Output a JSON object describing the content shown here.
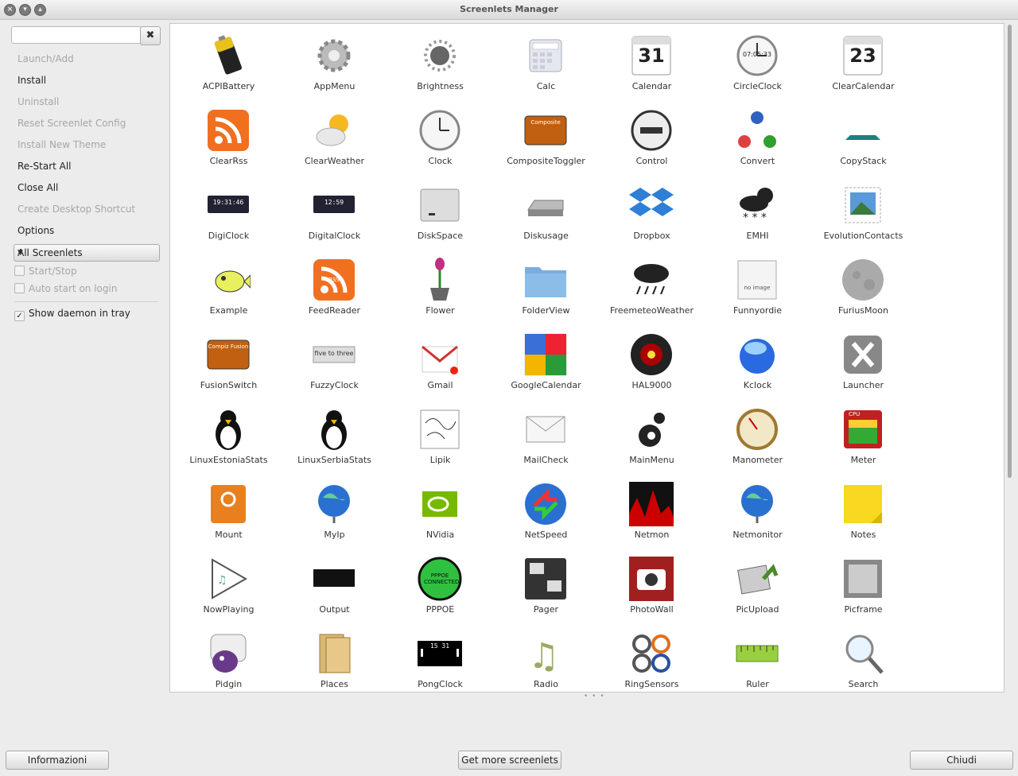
{
  "window": {
    "title": "Screenlets Manager"
  },
  "sidebar": {
    "search": {
      "value": "",
      "placeholder": ""
    },
    "clear_label": "✖",
    "menu": [
      {
        "label": "Launch/Add",
        "enabled": false
      },
      {
        "label": "Install",
        "enabled": true
      },
      {
        "label": "Uninstall",
        "enabled": false
      },
      {
        "label": "Reset Screenlet Config",
        "enabled": false
      },
      {
        "label": "Install New Theme",
        "enabled": false
      },
      {
        "label": "Re-Start All",
        "enabled": true
      },
      {
        "label": "Close All",
        "enabled": true
      },
      {
        "label": "Create Desktop Shortcut",
        "enabled": false
      },
      {
        "label": "Options",
        "enabled": true
      }
    ],
    "filter": {
      "selected": "All Screenlets"
    },
    "checks": [
      {
        "label": "Start/Stop",
        "checked": false,
        "enabled": false
      },
      {
        "label": "Auto start on login",
        "checked": false,
        "enabled": false
      },
      {
        "label": "Show daemon in tray",
        "checked": true,
        "enabled": true
      }
    ]
  },
  "screenlets": [
    {
      "name": "ACPIBattery",
      "icon": "battery-icon"
    },
    {
      "name": "AppMenu",
      "icon": "gear-icon"
    },
    {
      "name": "Brightness",
      "icon": "sun-icon"
    },
    {
      "name": "Calc",
      "icon": "calculator-icon"
    },
    {
      "name": "Calendar",
      "icon": "calendar-icon",
      "text": "31"
    },
    {
      "name": "CircleClock",
      "icon": "clock-icon",
      "text": "07:05:33"
    },
    {
      "name": "ClearCalendar",
      "icon": "calendar-icon",
      "text": "23"
    },
    {
      "name": "ClearRss",
      "icon": "rss-icon"
    },
    {
      "name": "ClearWeather",
      "icon": "weather-icon"
    },
    {
      "name": "Clock",
      "icon": "clock-icon"
    },
    {
      "name": "CompositeToggler",
      "icon": "toggle-icon",
      "text": "Composite"
    },
    {
      "name": "Control",
      "icon": "stop-icon"
    },
    {
      "name": "Convert",
      "icon": "convert-icon"
    },
    {
      "name": "CopyStack",
      "icon": "stack-icon"
    },
    {
      "name": "DigiClock",
      "icon": "digital-clock-icon",
      "text": "19:31:46"
    },
    {
      "name": "DigitalClock",
      "icon": "digital-clock-icon",
      "text": "12:59"
    },
    {
      "name": "DiskSpace",
      "icon": "disk-icon"
    },
    {
      "name": "Diskusage",
      "icon": "drive-icon"
    },
    {
      "name": "Dropbox",
      "icon": "dropbox-icon"
    },
    {
      "name": "EMHI",
      "icon": "snow-cloud-icon"
    },
    {
      "name": "EvolutionContacts",
      "icon": "stamp-icon"
    },
    {
      "name": "Example",
      "icon": "fish-icon"
    },
    {
      "name": "FeedReader",
      "icon": "rss-icon",
      "text": "RSS"
    },
    {
      "name": "Flower",
      "icon": "flower-icon"
    },
    {
      "name": "FolderView",
      "icon": "folder-icon"
    },
    {
      "name": "FreemeteoWeather",
      "icon": "rain-cloud-icon"
    },
    {
      "name": "Funnyordie",
      "icon": "no-image-icon",
      "text": "no image"
    },
    {
      "name": "FuriusMoon",
      "icon": "moon-icon"
    },
    {
      "name": "FusionSwitch",
      "icon": "toggle-icon",
      "text": "Compiz Fusion"
    },
    {
      "name": "FuzzyClock",
      "icon": "text-clock-icon",
      "text": "five to three"
    },
    {
      "name": "Gmail",
      "icon": "gmail-icon"
    },
    {
      "name": "GoogleCalendar",
      "icon": "google-icon"
    },
    {
      "name": "HAL9000",
      "icon": "hal-icon"
    },
    {
      "name": "Kclock",
      "icon": "orb-icon"
    },
    {
      "name": "Launcher",
      "icon": "launcher-icon"
    },
    {
      "name": "LinuxEstoniaStats",
      "icon": "penguin-icon"
    },
    {
      "name": "LinuxSerbiaStats",
      "icon": "penguin-icon"
    },
    {
      "name": "Lipik",
      "icon": "sketch-icon"
    },
    {
      "name": "MailCheck",
      "icon": "mail-icon"
    },
    {
      "name": "MainMenu",
      "icon": "gnome-icon"
    },
    {
      "name": "Manometer",
      "icon": "gauge-icon"
    },
    {
      "name": "Meter",
      "icon": "meter-icon",
      "text": "CPU"
    },
    {
      "name": "Mount",
      "icon": "mount-icon"
    },
    {
      "name": "MyIp",
      "icon": "globe-icon"
    },
    {
      "name": "NVidia",
      "icon": "nvidia-icon"
    },
    {
      "name": "NetSpeed",
      "icon": "netspeed-icon"
    },
    {
      "name": "Netmon",
      "icon": "graph-icon"
    },
    {
      "name": "Netmonitor",
      "icon": "globe-icon"
    },
    {
      "name": "Notes",
      "icon": "note-icon"
    },
    {
      "name": "NowPlaying",
      "icon": "play-icon"
    },
    {
      "name": "Output",
      "icon": "terminal-icon"
    },
    {
      "name": "PPPOE",
      "icon": "pppoe-icon",
      "text": "PPPOE CONNECTED"
    },
    {
      "name": "Pager",
      "icon": "pager-icon"
    },
    {
      "name": "PhotoWall",
      "icon": "camera-icon"
    },
    {
      "name": "PicUpload",
      "icon": "upload-icon"
    },
    {
      "name": "Picframe",
      "icon": "frame-icon"
    },
    {
      "name": "Pidgin",
      "icon": "pidgin-icon"
    },
    {
      "name": "Places",
      "icon": "folders-icon"
    },
    {
      "name": "PongClock",
      "icon": "pong-icon",
      "text": "15 31"
    },
    {
      "name": "Radio",
      "icon": "music-icon"
    },
    {
      "name": "RingSensors",
      "icon": "rings-icon"
    },
    {
      "name": "Ruler",
      "icon": "ruler-icon"
    },
    {
      "name": "Search",
      "icon": "magnifier-icon"
    }
  ],
  "footer": {
    "info_label": "Informazioni",
    "more_label": "Get more screenlets",
    "close_label": "Chiudi"
  }
}
